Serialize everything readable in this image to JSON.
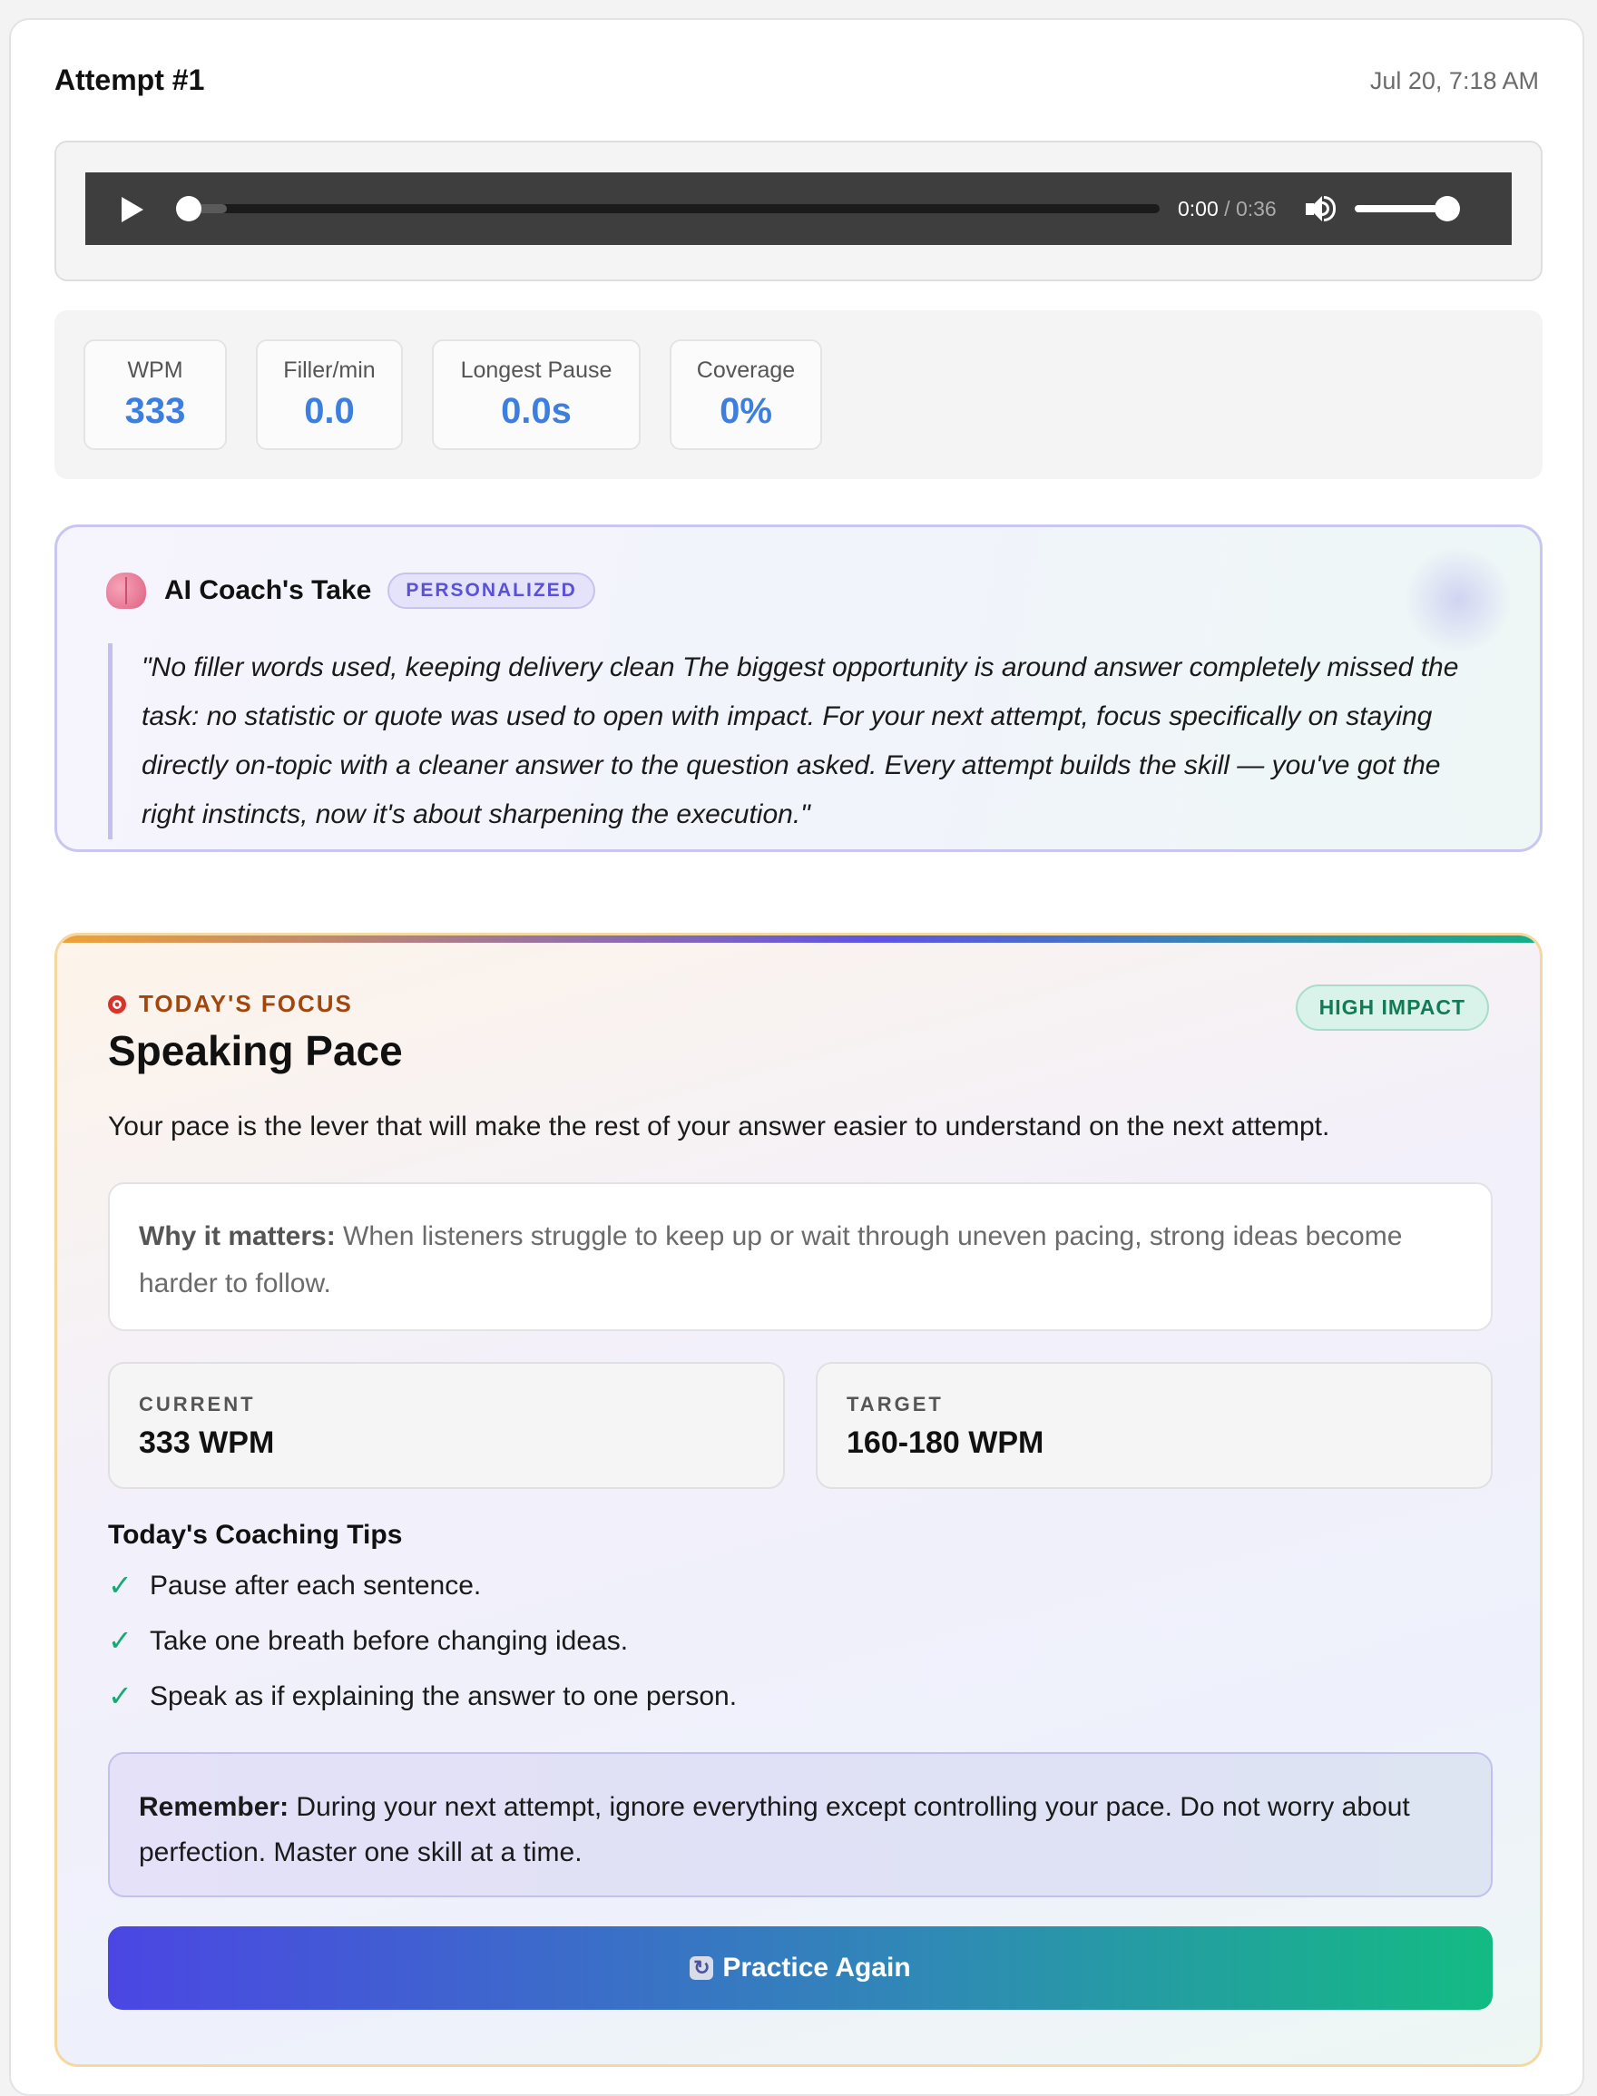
{
  "header": {
    "title": "Attempt #1",
    "date": "Jul 20, 7:18 AM"
  },
  "player": {
    "current_time": "0:00",
    "separator": " / ",
    "duration": "0:36",
    "volume_level": 1.0
  },
  "metrics": [
    {
      "label": "WPM",
      "value": "333"
    },
    {
      "label": "Filler/min",
      "value": "0.0"
    },
    {
      "label": "Longest Pause",
      "value": "0.0s"
    },
    {
      "label": "Coverage",
      "value": "0%"
    }
  ],
  "coach": {
    "title": "AI Coach's Take",
    "badge": "PERSONALIZED",
    "quote": "\"No filler words used, keeping delivery clean The biggest opportunity is around answer completely missed the task: no statistic or quote was used to open with impact. For your next attempt, focus specifically on staying directly on-topic with a cleaner answer to the question asked. Every attempt builds the skill — you've got the right instincts, now it's about sharpening the execution.\""
  },
  "focus": {
    "kicker": "TODAY'S FOCUS",
    "badge": "HIGH IMPACT",
    "title": "Speaking Pace",
    "description": "Your pace is the lever that will make the rest of your answer easier to understand on the next attempt.",
    "why_label": "Why it matters:",
    "why_text": " When listeners struggle to keep up or wait through uneven pacing, strong ideas become harder to follow.",
    "current_label": "CURRENT",
    "current_value": "333 WPM",
    "target_label": "TARGET",
    "target_value": "160-180 WPM",
    "tips_title": "Today's Coaching Tips",
    "tips": [
      "Pause after each sentence.",
      "Take one breath before changing ideas.",
      "Speak as if explaining the answer to one person."
    ],
    "remember_label": "Remember:",
    "remember_text": " During your next attempt, ignore everything except controlling your pace. Do not worry about perfection. Master one skill at a time.",
    "button_label": "Practice Again"
  },
  "colors": {
    "metric_value": "#3d7fde",
    "personal_badge": "#5a51d6",
    "impact_badge": "#137a56",
    "check": "#16a974",
    "kicker": "#a1470e"
  },
  "icons": {
    "play": "play-icon",
    "volume": "volume-icon",
    "coach": "brain-icon",
    "focus": "target-icon",
    "tip": "check-icon",
    "button": "refresh-icon"
  }
}
